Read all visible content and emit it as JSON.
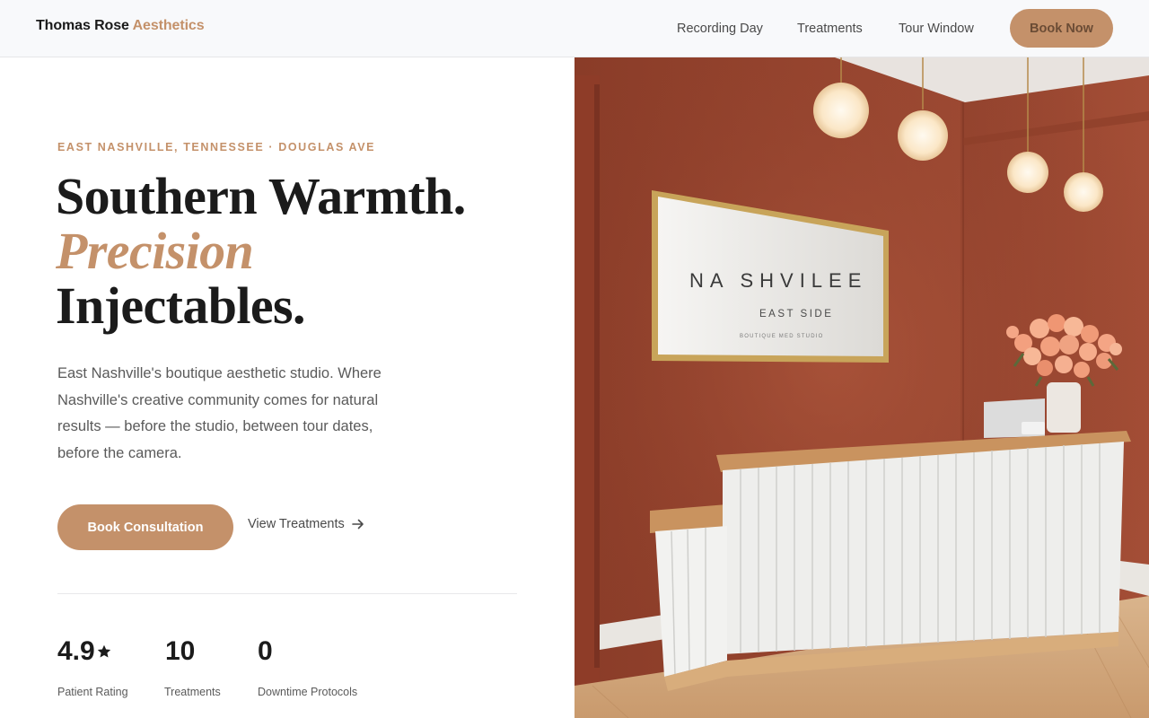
{
  "brand": {
    "name": "Thomas Rose",
    "accent": "Aesthetics"
  },
  "nav": {
    "items": [
      "Recording Day",
      "Treatments",
      "Tour Window"
    ],
    "cta": "Book Now"
  },
  "hero": {
    "eyebrow": "EAST NASHVILLE, TENNESSEE · DOUGLAS AVE",
    "headline_line1": "Southern Warmth.",
    "headline_line2": "Precision",
    "headline_line3": "Injectables.",
    "lede": "East Nashville's boutique aesthetic studio. Where Nashville's creative community comes for natural results — before the studio, between tour dates, before the camera.",
    "primary_cta": "Book Consultation",
    "secondary_cta": "View Treatments"
  },
  "stats": [
    {
      "value": "4.9",
      "label": "Patient Rating"
    },
    {
      "value": "10",
      "label": "Treatments"
    },
    {
      "value": "0",
      "label": "Downtime Protocols"
    }
  ],
  "photo": {
    "sign_title": "NA SHVILEE",
    "sign_subtitle": "EAST SIDE",
    "sign_small": "BOUTIQUE MED STUDIO"
  },
  "colors": {
    "accent": "#c4916a",
    "wall": "#9b4b35",
    "text_dark": "#1b1b1b",
    "text_muted": "#5a5a5a"
  }
}
